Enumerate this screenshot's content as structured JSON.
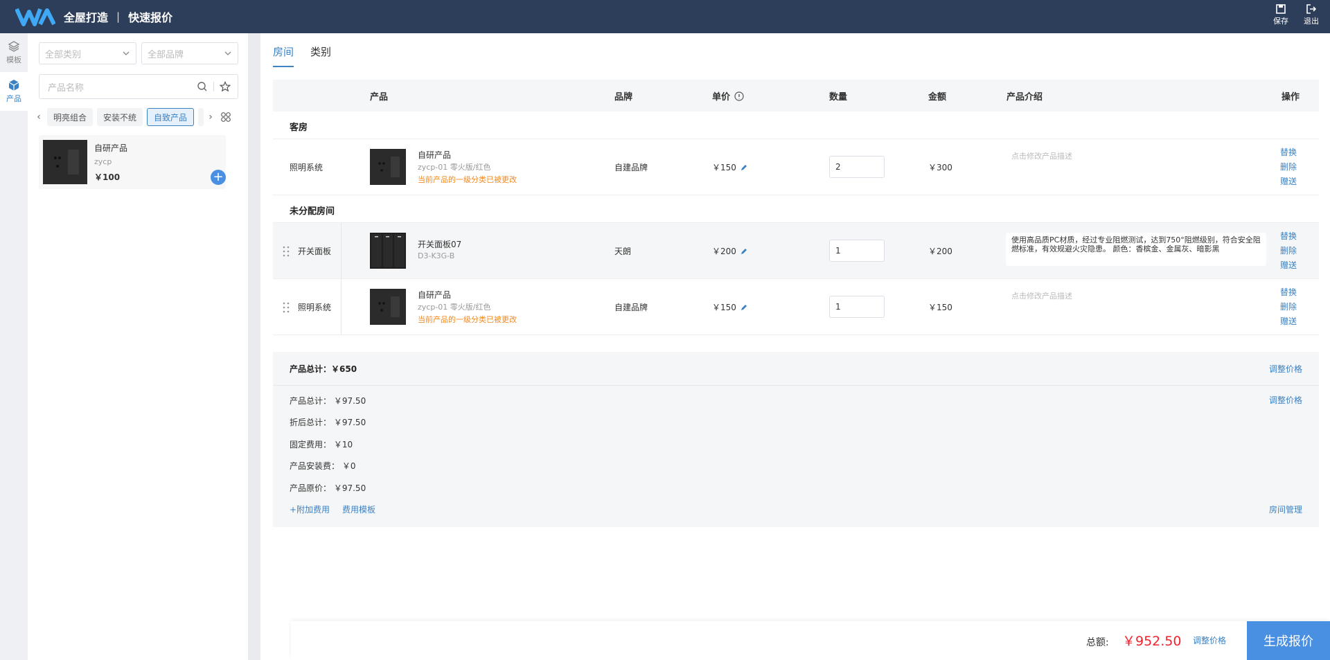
{
  "header": {
    "app_title": "全屋打造",
    "separator": "|",
    "page_title": "快速报价",
    "actions": [
      {
        "label": "保存",
        "icon": "save-icon"
      },
      {
        "label": "退出",
        "icon": "logout-icon"
      }
    ]
  },
  "rail": {
    "items": [
      {
        "label": "模板",
        "icon": "layers-icon",
        "active": false
      },
      {
        "label": "产品",
        "icon": "cube-icon",
        "active": true
      }
    ]
  },
  "panel": {
    "category_placeholder": "全部类别",
    "brand_placeholder": "全部品牌",
    "search_placeholder": "产品名称",
    "chips": [
      {
        "label": "明亮组合",
        "active": false
      },
      {
        "label": "安装不统",
        "active": false
      },
      {
        "label": "自致产品",
        "active": true
      }
    ],
    "product": {
      "name": "自研产品",
      "code": "zycp",
      "price": "￥100"
    }
  },
  "tabs": [
    {
      "label": "房间",
      "active": true
    },
    {
      "label": "类别",
      "active": false
    }
  ],
  "table": {
    "headers": {
      "product": "产品",
      "brand": "品牌",
      "unit_price": "单价",
      "quantity": "数量",
      "amount": "金额",
      "intro": "产品介绍",
      "actions": "操作"
    },
    "groups": [
      {
        "name": "客房"
      },
      {
        "name": "未分配房间"
      }
    ],
    "rows": [
      {
        "room": "照明系统",
        "name": "自研产品",
        "spec": "zycp-01 零火版/红色",
        "warning": "当前产品的一级分类已被更改",
        "brand": "自建品牌",
        "price": "￥150",
        "qty": "2",
        "amount": "￥300",
        "desc_placeholder": "点击修改产品描述"
      },
      {
        "room": "开关面板",
        "name": "开关面板07",
        "spec": "D3-K3G-B",
        "brand": "天朗",
        "price": "￥200",
        "qty": "1",
        "amount": "￥200",
        "desc": "使用高品质PC材质，经过专业阻燃测试，达到750°阻燃级别，符合安全阻燃标准，有效规避火灾隐患。 颜色：香槟金、金属灰、暗影黑"
      },
      {
        "room": "照明系统",
        "name": "自研产品",
        "spec": "zycp-01 零火版/红色",
        "warning": "当前产品的一级分类已被更改",
        "brand": "自建品牌",
        "price": "￥150",
        "qty": "1",
        "amount": "￥150",
        "desc_placeholder": "点击修改产品描述"
      }
    ],
    "ops": {
      "replace": "替换",
      "delete": "删除",
      "gift": "赠送"
    }
  },
  "summary": {
    "product_total": "产品总计：￥650",
    "adjust_price": "调整价格",
    "items": [
      {
        "label": "产品总计：",
        "value": "￥97.50"
      },
      {
        "label": "折后总计：",
        "value": "￥97.50"
      },
      {
        "label": "固定费用：",
        "value": "￥10"
      },
      {
        "label": "产品安装费：",
        "value": "￥0"
      },
      {
        "label": "产品原价：",
        "value": "￥97.50"
      }
    ],
    "add_fee": "+附加费用",
    "fee_template": "费用模板",
    "room_manage": "房间管理"
  },
  "footer": {
    "total_label": "总额:",
    "total_value": "￥952.50",
    "adjust": "调整价格",
    "generate": "生成报价"
  },
  "colors": {
    "topbar": "#2d3e5a",
    "accent": "#3b82c4",
    "price_red": "#f5222d",
    "warning": "#f08a24"
  }
}
